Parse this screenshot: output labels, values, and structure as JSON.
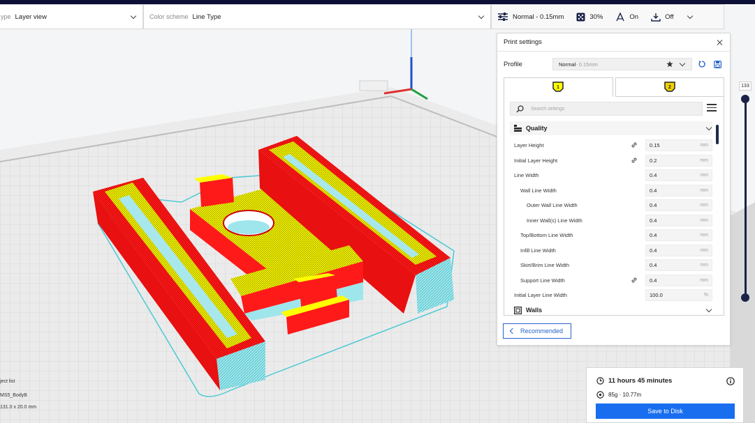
{
  "toolbar": {
    "view_type_caption": "ype",
    "view_type_value": "Layer view",
    "color_scheme_caption": "Color scheme",
    "color_scheme_value": "Line Type",
    "print_profile": "Normal - 0.15mm",
    "infill": "30%",
    "support": "On",
    "adhesion": "Off"
  },
  "print_settings": {
    "title": "Print settings",
    "profile_label": "Profile",
    "profile_name": "Normal",
    "profile_suffix": " - 0.15mm",
    "extruders": [
      "1",
      "2"
    ],
    "search_placeholder": "Search settings",
    "categories": {
      "quality": "Quality",
      "walls": "Walls"
    },
    "settings": [
      {
        "label": "Layer Height",
        "value": "0.15",
        "unit": "mm"
      },
      {
        "label": "Initial Layer Height",
        "value": "0.2",
        "unit": "mm"
      },
      {
        "label": "Line Width",
        "value": "0.4",
        "unit": "mm"
      },
      {
        "label": "Wall Line Width",
        "value": "0.4",
        "unit": "mm"
      },
      {
        "label": "Outer Wall Line Width",
        "value": "0.4",
        "unit": "mm"
      },
      {
        "label": "Inner Wall(s) Line Width",
        "value": "0.4",
        "unit": "mm"
      },
      {
        "label": "Top/Bottom Line Width",
        "value": "0.4",
        "unit": "mm"
      },
      {
        "label": "Infill Line Width",
        "value": "0.4",
        "unit": "mm"
      },
      {
        "label": "Skirt/Brim Line Width",
        "value": "0.4",
        "unit": "mm"
      },
      {
        "label": "Support Line Width",
        "value": "0.4",
        "unit": "mm"
      },
      {
        "label": "Initial Layer Line Width",
        "value": "100.0",
        "unit": "%"
      }
    ],
    "recommended_label": "Recommended"
  },
  "layer_slider": {
    "value": "133"
  },
  "job": {
    "time": "11 hours 45 minutes",
    "material": "85g · 10.77m",
    "save_label": "Save to Disk"
  },
  "object_list": {
    "title": "ject list",
    "object_name": "MS5_BodyB",
    "dimensions": "131.0 x 20.0 mm"
  },
  "colors": {
    "accent": "#196ef0",
    "navy": "#1a2249",
    "wall_red": "#ff1a1a",
    "infill_yellow": "#ffff00",
    "support_cyan": "#5ee0e8"
  }
}
